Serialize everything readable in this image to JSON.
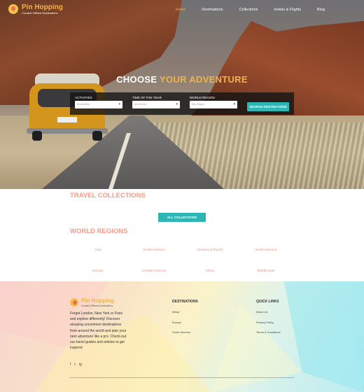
{
  "brand": {
    "name": "Pin Hopping",
    "tagline": "Curated Offbeat Destinations"
  },
  "nav": {
    "items": [
      "Home",
      "Destinations",
      "Collections",
      "Hotels & Flights",
      "Blog"
    ],
    "active": "Home"
  },
  "hero": {
    "title_part1": "CHOOSE",
    "title_part2": "YOUR ADVENTURE",
    "fields": [
      {
        "label": "ACTIVITIES",
        "placeholder": "Any Activity"
      },
      {
        "label": "TIME OF THE YEAR",
        "placeholder": "Any Month"
      },
      {
        "label": "WORLD REGION",
        "placeholder": "Any Region"
      }
    ],
    "search_button": "SEARCH DESTINATIONS"
  },
  "collections": {
    "title": "TRAVEL COLLECTIONS",
    "button": "ALL COLLECTIONS"
  },
  "regions": {
    "title": "WORLD REGIONS",
    "items": [
      "Asia",
      "South America",
      "Oceania & Pacific",
      "North America",
      "Europe",
      "Central America",
      "Africa",
      "Middle East"
    ]
  },
  "footer": {
    "about": "Forget London, New York or Paris and explore differently! Discover amazing uncommon destinations from around the world and plan your next adventure like a pro. Check-out our travel guides and articles to get inspired",
    "social": [
      "f",
      "t",
      "ig"
    ],
    "destinations": {
      "title": "DESTINATIONS",
      "links": [
        "Africa",
        "Europe",
        "South America"
      ]
    },
    "quick_links": {
      "title": "QUICK LINKS",
      "links": [
        "About Us",
        "Privacy Policy",
        "Terms & Conditions"
      ]
    }
  },
  "colors": {
    "accent": "#f2b14b",
    "teal": "#2fb5b3",
    "coral": "#f28a72"
  }
}
